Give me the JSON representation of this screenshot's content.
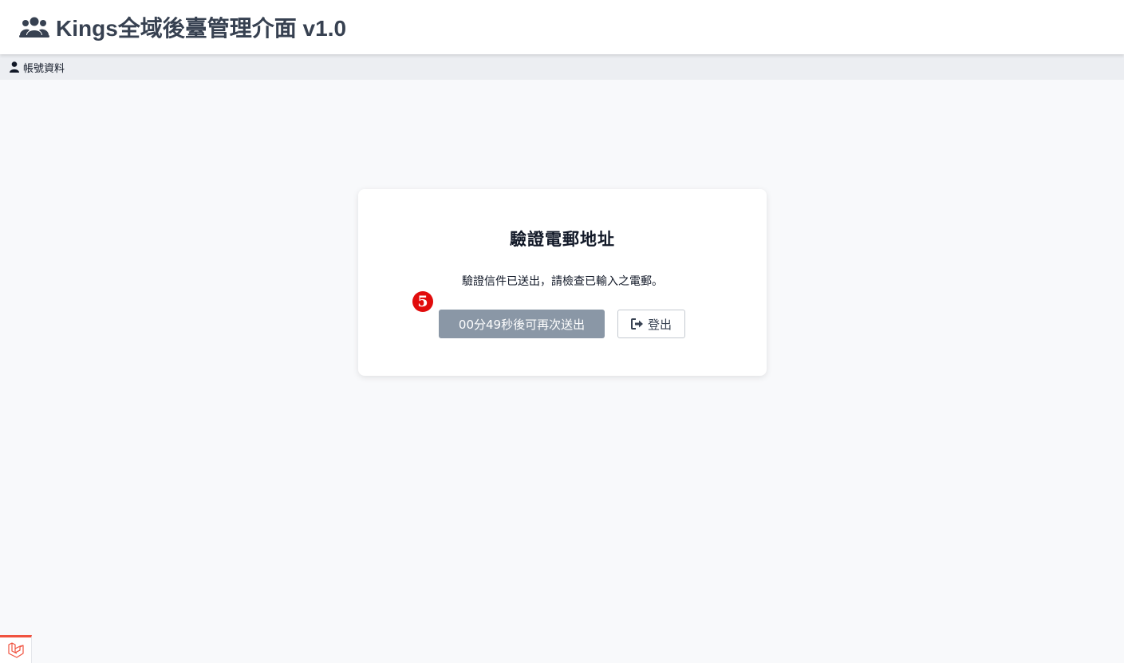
{
  "header": {
    "title": "Kings全域後臺管理介面 v1.0",
    "icon": "users-icon"
  },
  "subnav": {
    "items": [
      {
        "label": "帳號資料",
        "icon": "user-icon"
      }
    ]
  },
  "card": {
    "title": "驗證電郵地址",
    "message": "驗證信件已送出，請檢查已輸入之電郵。",
    "step_badge": "5",
    "resend_button_label": "00分49秒後可再次送出",
    "logout_button_label": "登出"
  },
  "debug_badge": {
    "icon": "laravel-logo-icon"
  },
  "colors": {
    "header_bg": "#ffffff",
    "subnav_bg": "#eceef2",
    "page_bg": "#f8f9fb",
    "resend_button_bg": "#8a97a6",
    "step_badge_bg": "#e10c0c",
    "debug_accent": "#f05340"
  }
}
